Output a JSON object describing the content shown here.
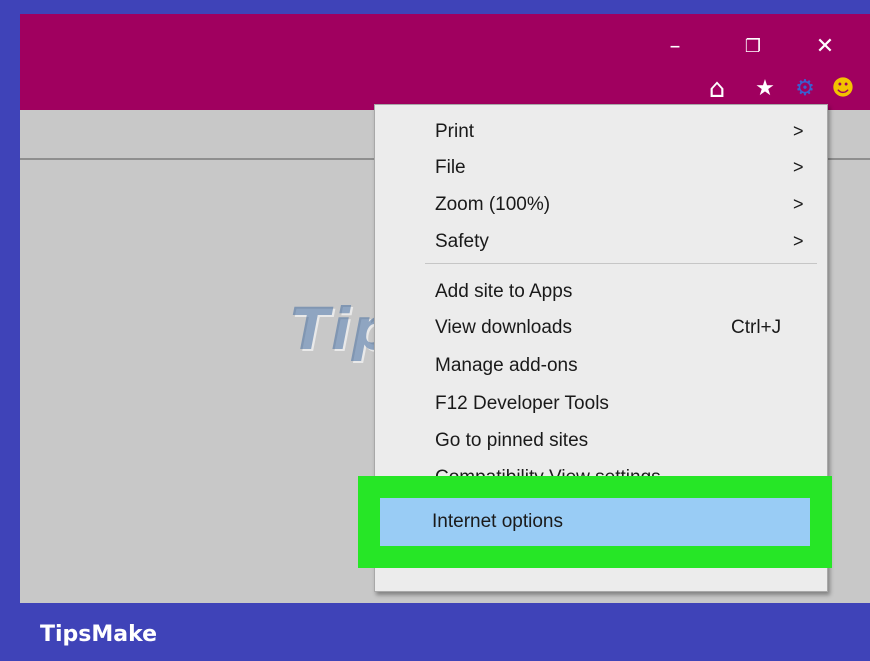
{
  "window_controls": {
    "minimize": "–",
    "restore": "❐",
    "close": "✕"
  },
  "toolbar_icons": [
    {
      "name": "home-icon",
      "glyph": "⌂"
    },
    {
      "name": "favorites-star-icon",
      "glyph": "★"
    },
    {
      "name": "gear-icon",
      "glyph": "⚙"
    },
    {
      "name": "feedback-smiley-icon",
      "glyph": "☻"
    }
  ],
  "menu": {
    "items": [
      {
        "label": "Print",
        "arrow": ">"
      },
      {
        "label": "File",
        "arrow": ">"
      },
      {
        "label": "Zoom (100%)",
        "arrow": ">"
      },
      {
        "label": "Safety",
        "arrow": ">"
      },
      {
        "label": "Add site to Apps"
      },
      {
        "label": "View downloads",
        "shortcut": "Ctrl+J"
      },
      {
        "label": "Manage add-ons"
      },
      {
        "label": "F12 Developer Tools"
      },
      {
        "label": "Go to pinned sites"
      },
      {
        "label": "Compatibility View settings"
      }
    ],
    "highlighted": "Internet options"
  },
  "watermark": "TipsMake",
  "footer_brand": "TipsMake",
  "colors": {
    "titlebar": "#a0005f",
    "frame": "#3f43b8",
    "highlight_outline": "#26e626",
    "highlight_fill": "#99ccf5",
    "gear": "#3a5fd0",
    "smiley": "#f2c200"
  }
}
